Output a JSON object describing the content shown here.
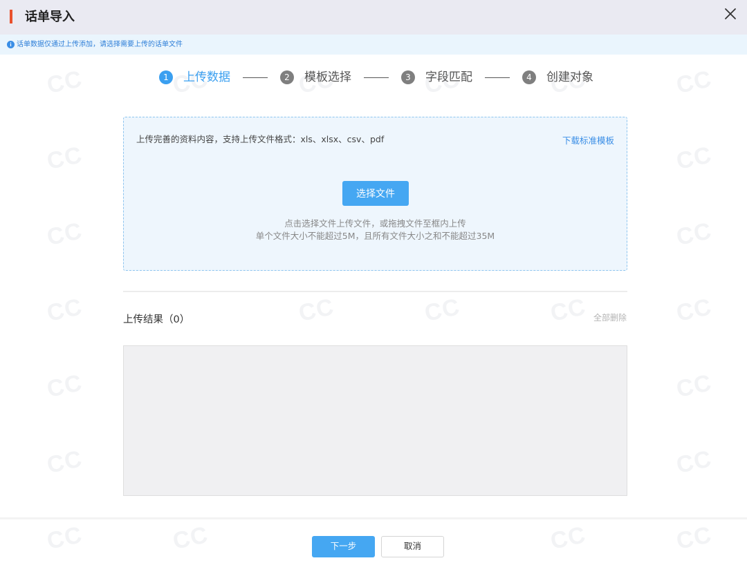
{
  "header": {
    "title": "话单导入",
    "accent_color": "#e9512d",
    "close_icon": "close-icon"
  },
  "tip": {
    "icon": "info-icon",
    "text": "话单数据仅通过上传添加，请选择需要上传的话单文件"
  },
  "steps": [
    {
      "number": "1",
      "label": "上传数据",
      "active": true
    },
    {
      "number": "2",
      "label": "模板选择",
      "active": false
    },
    {
      "number": "3",
      "label": "字段匹配",
      "active": false
    },
    {
      "number": "4",
      "label": "创建对象",
      "active": false
    }
  ],
  "upload": {
    "description": "上传完善的资料内容，支持上传文件格式：xls、xlsx、csv、pdf",
    "download_template": "下载标准模板",
    "choose_button": "选择文件",
    "hint_line1": "点击选择文件上传文件，或拖拽文件至框内上传",
    "hint_line2": "单个文件大小不能超过5M，且所有文件大小之和不能超过35M"
  },
  "results": {
    "title": "上传结果（0）",
    "delete_all": "全部删除"
  },
  "footer": {
    "next_button": "下一步",
    "cancel_button": "取消"
  },
  "watermark": "CC",
  "colors": {
    "primary": "#45a7f2",
    "active_step": "#3a9ff0",
    "link": "#3a8ee6"
  }
}
